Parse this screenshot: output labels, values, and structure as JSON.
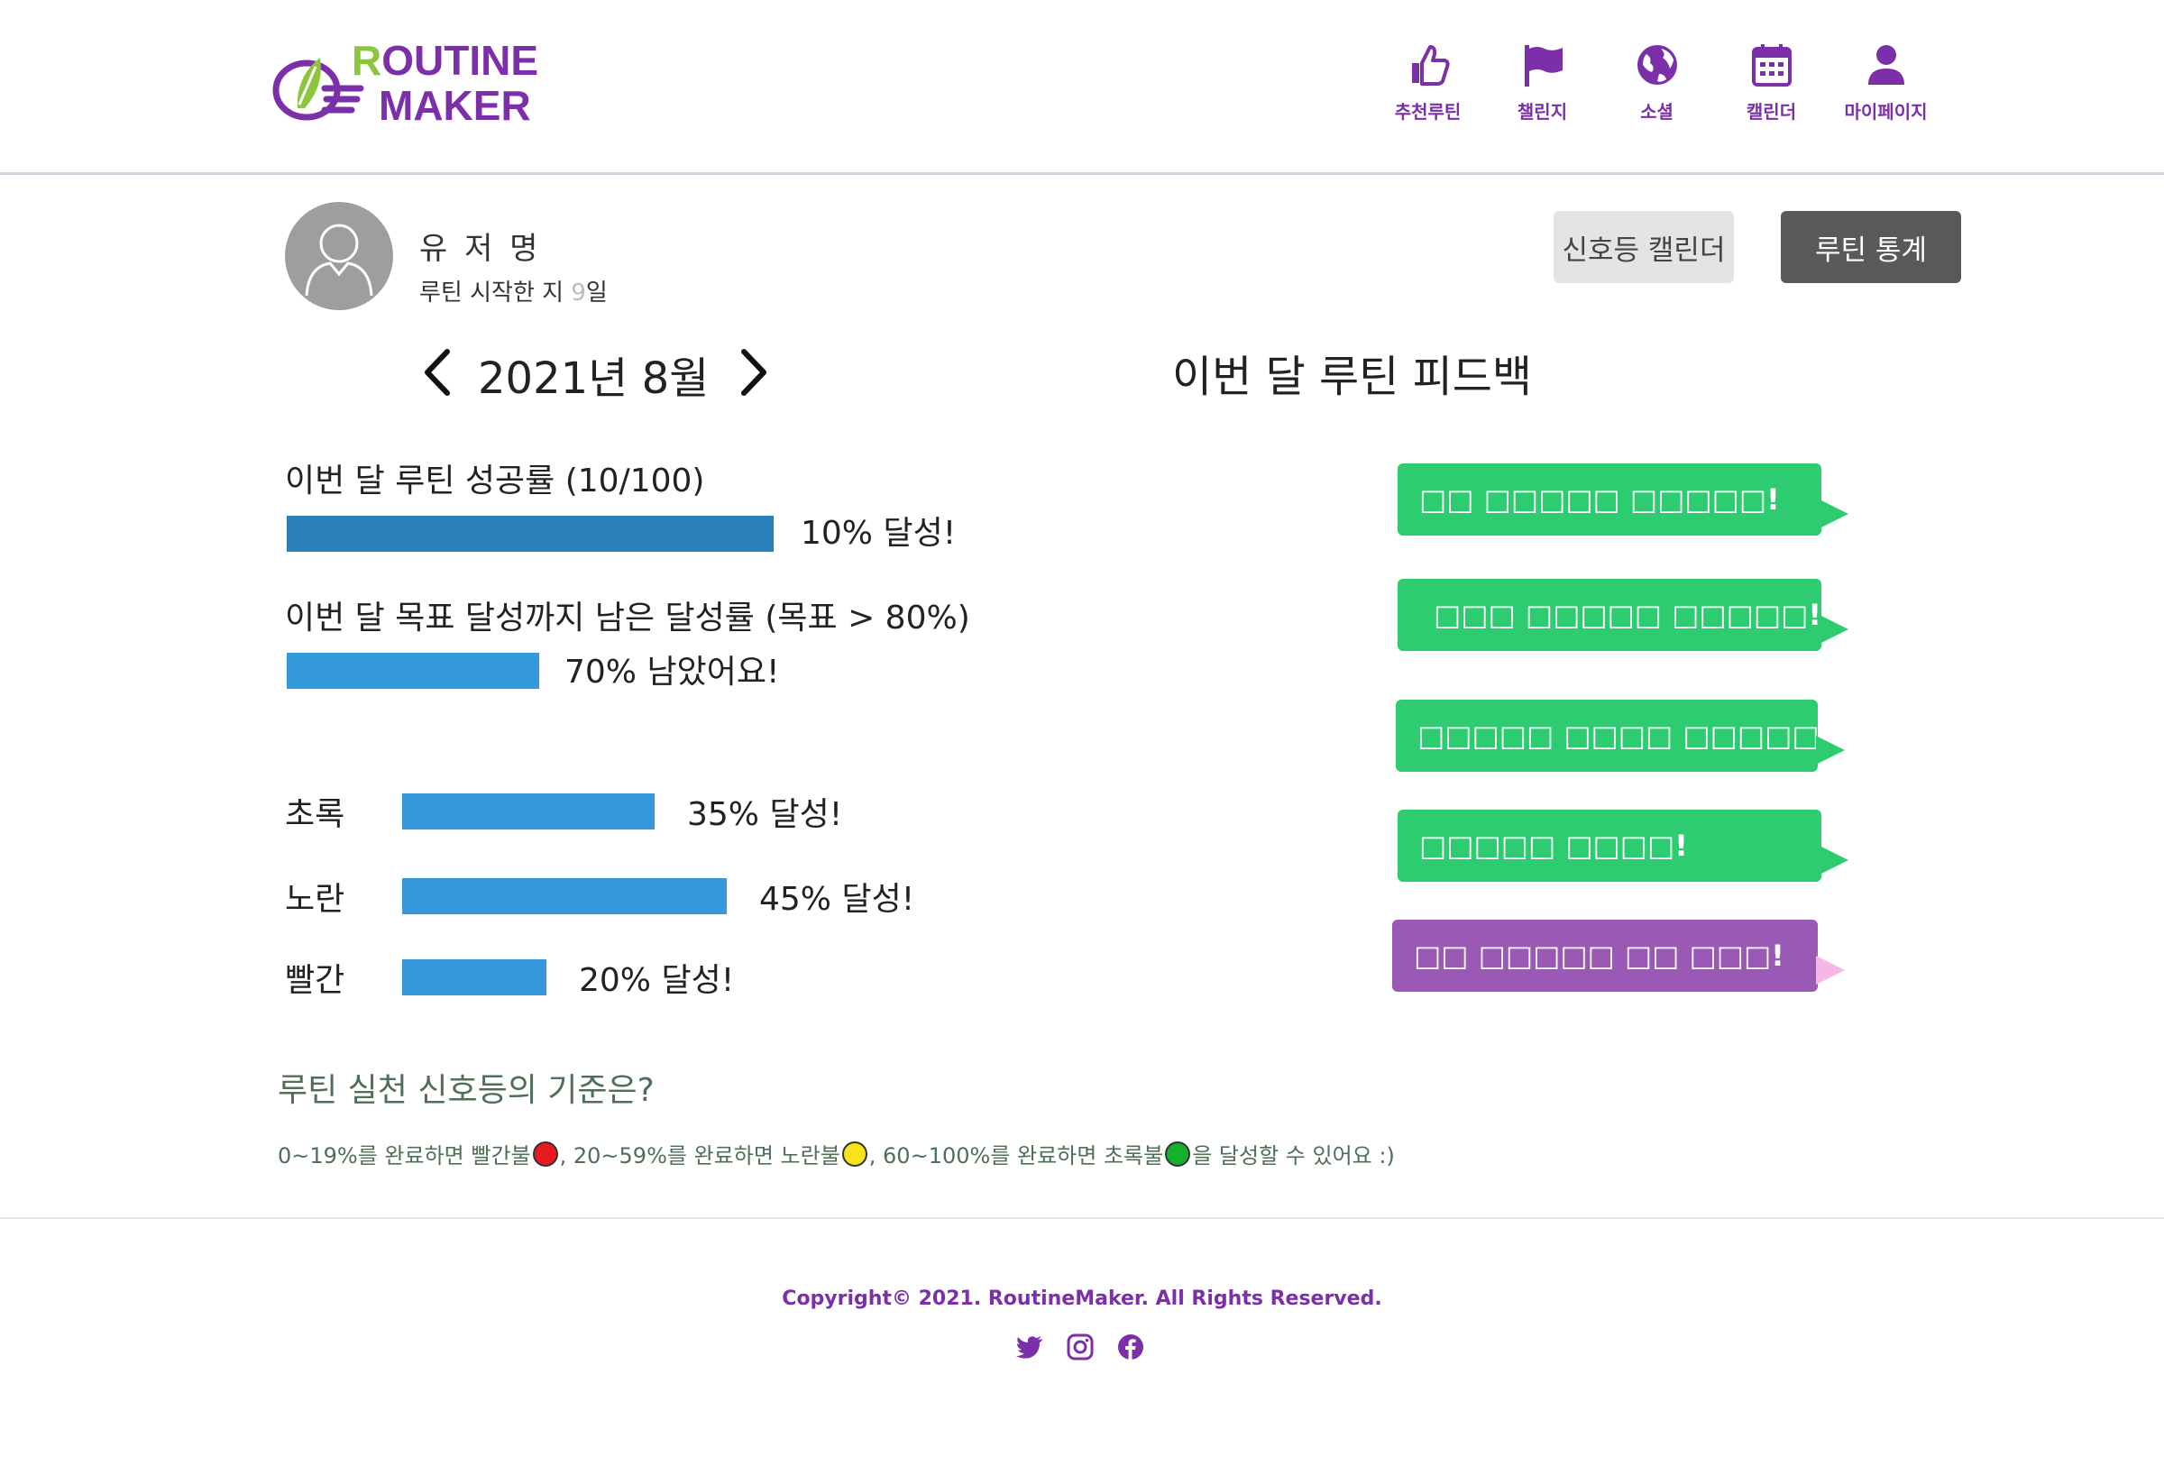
{
  "brand": {
    "line1_first": "R",
    "line1_rest": "OUTINE",
    "line2": "MAKER"
  },
  "nav": {
    "recommend": "추천루틴",
    "challenge": "챌린지",
    "social": "소셜",
    "calendar": "캘린더",
    "mypage": "마이페이지"
  },
  "profile": {
    "name": "유 저 명",
    "days_prefix": "루틴 시작한 지 ",
    "days_num": "9",
    "days_suffix": "일"
  },
  "buttons": {
    "signal_calendar": "신호등 캘린더",
    "routine_stats": "루틴 통계"
  },
  "month": {
    "title": "2021년 8월"
  },
  "feedback": {
    "title": "이번 달 루틴 피드백",
    "bubbles": [
      {
        "text": "□□ □□□□□ □□□□□!",
        "color": "#2ecc71"
      },
      {
        "text": "□□□ □□□□□ □□□□□!",
        "color": "#2ecc71"
      },
      {
        "text": "□□□□□ □□□□ □□□□□!",
        "color": "#2ecc71"
      },
      {
        "text": "□□□□□ □□□□!",
        "color": "#2ecc71"
      },
      {
        "text": "□□ □□□□□ □□ □□□!",
        "color": "#9b59b6"
      }
    ]
  },
  "stats": {
    "success_label": "이번 달 루틴 성공률 (10/100)",
    "success_text": "10% 달성!",
    "success_value": 10,
    "remain_label": "이번 달 목표 달성까지 남은 달성률 (목표 > 80%)",
    "remain_text": "70% 남았어요!",
    "remain_value": 70,
    "colors": [
      {
        "label": "초록",
        "text": "35% 달성!",
        "value": 35
      },
      {
        "label": "노란",
        "text": "45% 달성!",
        "value": 45
      },
      {
        "label": "빨간",
        "text": "20% 달성!",
        "value": 20
      }
    ]
  },
  "criteria": {
    "title": "루틴 실천 신호등의 기준은?",
    "part1": "0~19%를 완료하면 빨간불",
    "part2": ", 20~59%를 완료하면 노란불",
    "part3": ", 60~100%를 완료하면 초록불",
    "part4": " 을 달성할 수 있어요 :)",
    "red": "#e8191f",
    "yellow": "#f7e21b",
    "green": "#16b12b"
  },
  "footer": {
    "copyright": "Copyright© 2021. RoutineMaker. All Rights Reserved."
  },
  "colors": {
    "accent": "#7b2fa8",
    "bar_dark": "#2980b9",
    "bar": "#3498db"
  }
}
